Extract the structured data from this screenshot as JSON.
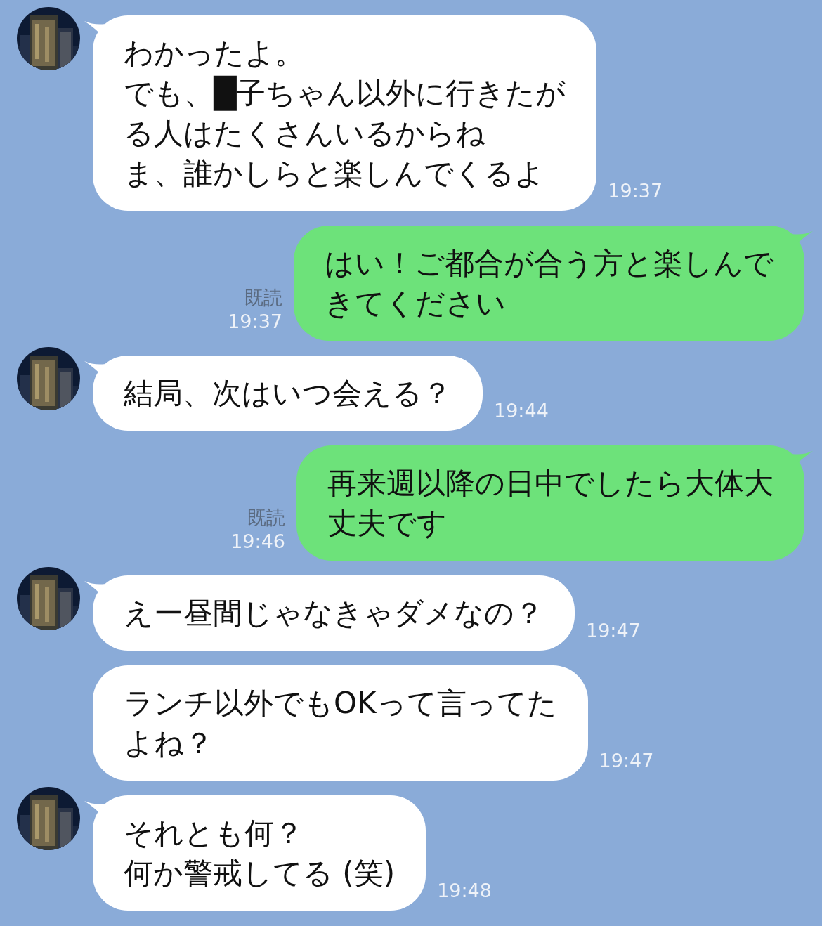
{
  "messages": [
    {
      "kind": "incoming",
      "show_avatar": true,
      "lines": [
        "わかったよ。",
        "でも、█子ちゃん以外に行きたが",
        "る人はたくさんいるからね",
        "ま、誰かしらと楽しんでくるよ"
      ],
      "time": "19:37"
    },
    {
      "kind": "outgoing",
      "lines": [
        "はい！ご都合が合う方と楽しんで",
        "きてください"
      ],
      "read": "既読",
      "time": "19:37"
    },
    {
      "kind": "incoming",
      "show_avatar": true,
      "lines": [
        "結局、次はいつ会える？"
      ],
      "time": "19:44"
    },
    {
      "kind": "outgoing",
      "lines": [
        "再来週以降の日中でしたら大体大",
        "丈夫です"
      ],
      "read": "既読",
      "time": "19:46"
    },
    {
      "kind": "incoming",
      "show_avatar": true,
      "lines": [
        "えー昼間じゃなきゃダメなの？"
      ],
      "time": "19:47"
    },
    {
      "kind": "incoming",
      "show_avatar": false,
      "lines": [
        "ランチ以外でもOKって言ってた",
        "よね？"
      ],
      "time": "19:47"
    },
    {
      "kind": "incoming",
      "show_avatar": true,
      "lines": [
        "それとも何？",
        "何か警戒してる (笑)"
      ],
      "time": "19:48"
    }
  ]
}
